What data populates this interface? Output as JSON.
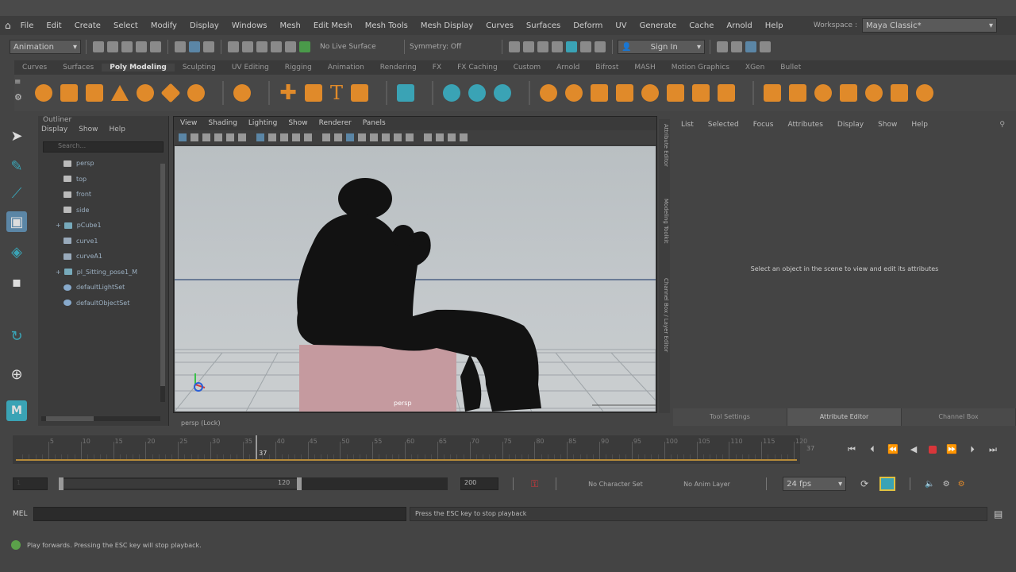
{
  "menubar": {
    "items": [
      "File",
      "Edit",
      "Create",
      "Select",
      "Modify",
      "Display",
      "Windows",
      "Mesh",
      "Edit Mesh",
      "Mesh Tools",
      "Mesh Display",
      "Curves",
      "Surfaces",
      "Deform",
      "UV",
      "Generate",
      "Cache",
      "Arnold",
      "Help"
    ],
    "workspace_label": "Workspace :",
    "workspace_value": "Maya Classic*"
  },
  "statusline": {
    "mode": "Animation",
    "live_surface": "No Live Surface",
    "symmetry": "Symmetry: Off",
    "sign_in": "Sign In"
  },
  "shelf": {
    "tabs": [
      "Curves",
      "Surfaces",
      "Poly Modeling",
      "Sculpting",
      "UV Editing",
      "Rigging",
      "Animation",
      "Rendering",
      "FX",
      "FX Caching",
      "Custom",
      "Arnold",
      "Bifrost",
      "MASH",
      "Motion Graphics",
      "XGen",
      "Bullet"
    ]
  },
  "outliner": {
    "title": "Outliner",
    "menu": [
      "Display",
      "Show",
      "Help"
    ],
    "search_placeholder": "Search...",
    "items": [
      "persp",
      "top",
      "front",
      "side",
      "pCube1",
      "curve1",
      "curveA1",
      "pl_Sitting_pose1_M",
      "defaultLightSet",
      "defaultObjectSet"
    ]
  },
  "viewport": {
    "menu": [
      "View",
      "Shading",
      "Lighting",
      "Show",
      "Renderer",
      "Panels"
    ],
    "label": "persp (Lock)",
    "box_label": "persp"
  },
  "attribute_editor": {
    "menu": [
      "List",
      "Selected",
      "Focus",
      "Attributes",
      "Display",
      "Show",
      "Help"
    ],
    "message": "Select an object in the scene to view and edit its attributes",
    "tabs": [
      "Tool Settings",
      "Attribute Editor",
      "Channel Box"
    ],
    "side_labels": [
      "Attribute Editor",
      "Modeling Toolkit",
      "Channel Box / Layer Editor"
    ]
  },
  "timeline": {
    "ticks": [
      "5",
      "10",
      "15",
      "20",
      "25",
      "30",
      "35",
      "40",
      "45",
      "50",
      "55",
      "60",
      "65",
      "70",
      "75",
      "80",
      "85",
      "90",
      "95",
      "100",
      "105",
      "110",
      "115",
      "120"
    ],
    "current_frame": "37",
    "current_field": "37"
  },
  "range": {
    "start": "1",
    "range_start": "1",
    "range_end": "120",
    "end": "200",
    "character_set": "No Character Set",
    "anim_layer": "No Anim Layer",
    "fps": "24 fps"
  },
  "command": {
    "lang": "MEL",
    "result": "Press the ESC key to stop playback"
  },
  "help": {
    "text": "Play forwards. Pressing the ESC key will stop playback."
  },
  "colors": {
    "accent_orange": "#e08a2a",
    "accent_teal": "#3aa3b5",
    "play_red": "#d8363a",
    "timeline_line": "#b58a3a"
  }
}
